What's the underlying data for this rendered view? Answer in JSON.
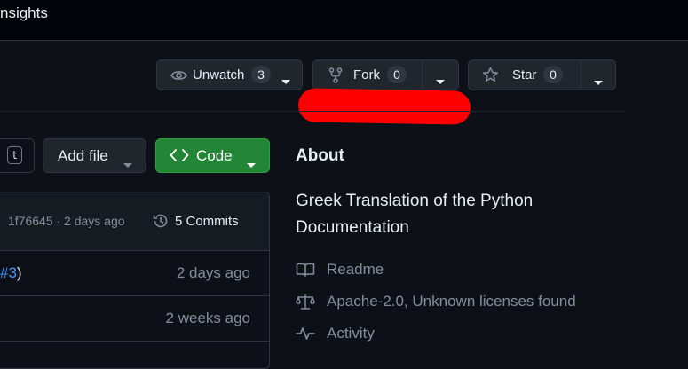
{
  "topnav": {
    "tab_insights": "nsights"
  },
  "repo_actions": {
    "unwatch": {
      "label": "Unwatch",
      "count": "3"
    },
    "fork": {
      "label": "Fork",
      "count": "0"
    },
    "star": {
      "label": "Star",
      "count": "0"
    }
  },
  "toolbar": {
    "kbd_hint": "t",
    "add_file_label": "Add file",
    "code_label": "Code"
  },
  "file_browser": {
    "latest_commit": "1f76645 · 2 days ago",
    "commits_label": "5 Commits",
    "rows": [
      {
        "message_link": "#3",
        "message_suffix": ")",
        "time": "2 days ago"
      },
      {
        "message_link": "",
        "message_suffix": "",
        "time": "2 weeks ago"
      }
    ]
  },
  "about": {
    "title": "About",
    "description": "Greek Translation of the Python Documentation",
    "readme": "Readme",
    "license": "Apache-2.0, Unknown licenses found",
    "activity": "Activity"
  },
  "colors": {
    "background": "#0d1117",
    "code_button": "#238636",
    "link": "#4493f8",
    "redaction": "#ff0000"
  }
}
